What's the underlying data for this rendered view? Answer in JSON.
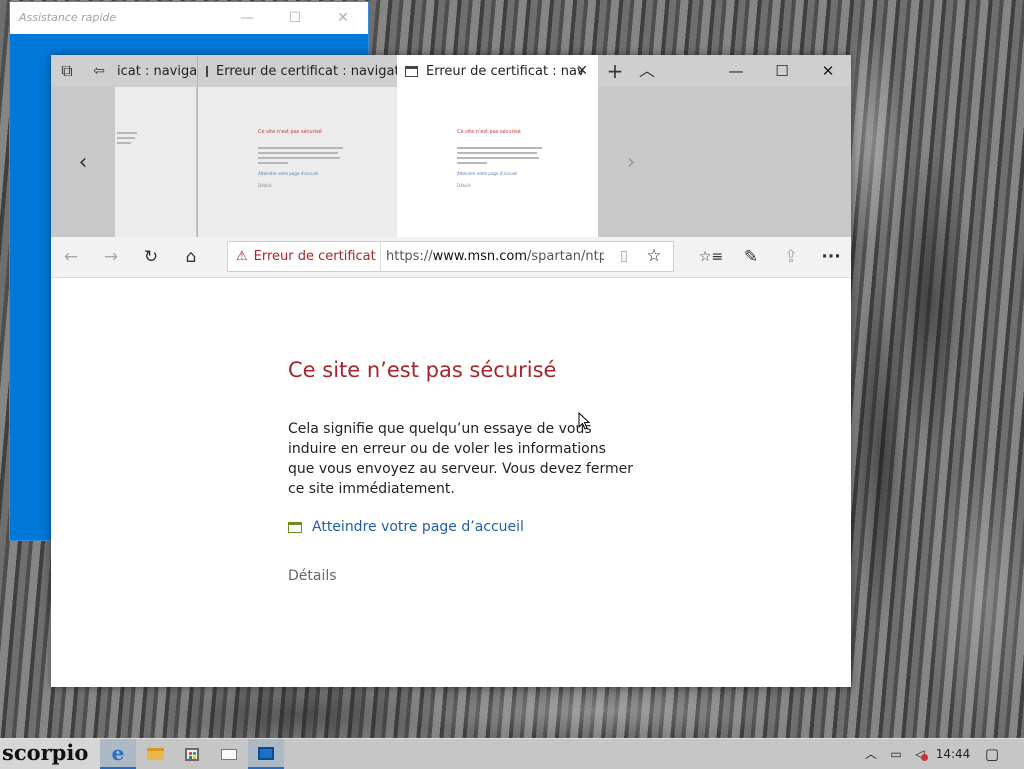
{
  "quick_assist": {
    "title": "Assistance rapide",
    "minimize": "—",
    "maximize": "☐",
    "close": "✕"
  },
  "edge": {
    "tabs": [
      {
        "label": "icat : navigat"
      },
      {
        "label": "Erreur de certificat : navigat"
      },
      {
        "label": "Erreur de certificat : nav",
        "close": "✕"
      }
    ],
    "tab_buttons": {
      "set_aside": "⧉",
      "restore": "⇦",
      "new_tab": "+",
      "tab_preview": "︿"
    },
    "window_buttons": {
      "minimize": "—",
      "maximize": "☐",
      "close": "✕"
    },
    "preview_nav": {
      "left": "‹",
      "right": "›"
    },
    "preview_page": {
      "title": "Ce site n'est pas sécurisé",
      "link": "Atteindre votre page d'accueil",
      "details": "Détails"
    },
    "navbar": {
      "back": "←",
      "forward": "→",
      "refresh": "↻",
      "home": "⌂",
      "cert_warning": "Erreur de certificat",
      "url_prefix": "https://",
      "url_domain": "www.msn.com",
      "url_path": "/spartan/ntp?loc",
      "reading_view": "▯",
      "favorite": "☆",
      "hub": "☆≡",
      "notes": "✎",
      "share": "⇪",
      "more": "···"
    },
    "page": {
      "title": "Ce site n’est pas sécurisé",
      "paragraph": "Cela signifie que quelqu’un essaye de vous induire en erreur ou de voler les informations que vous envoyez au serveur. Vous devez fermer ce site immédiatement.",
      "home_link": "Atteindre votre page d’accueil",
      "details": "Détails"
    }
  },
  "taskbar": {
    "logo": "scorpio",
    "clock": "14:44",
    "tray": {
      "chevron": "︿",
      "network": "▭",
      "volume": "◁",
      "notifications": "▢"
    }
  },
  "colors": {
    "error_red": "#a4262c",
    "link_blue": "#1f5fa8",
    "quick_assist_blue": "#0078d7"
  }
}
